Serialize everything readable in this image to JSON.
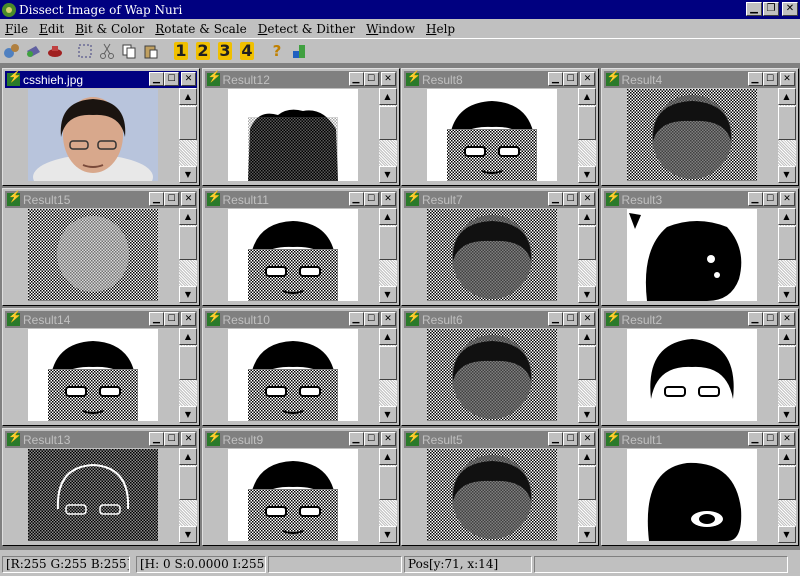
{
  "app": {
    "title": "Dissect Image of Wap Nuri"
  },
  "menu": [
    {
      "label": "File",
      "accel": "F",
      "rest": "ile"
    },
    {
      "label": "Edit",
      "accel": "E",
      "rest": "dit"
    },
    {
      "label": "Bit & Color",
      "accel": "B",
      "rest": "it & Color"
    },
    {
      "label": "Rotate & Scale",
      "accel": "R",
      "rest": "otate & Scale"
    },
    {
      "label": "Detect & Dither",
      "accel": "D",
      "rest": "etect & Dither"
    },
    {
      "label": "Window",
      "accel": "W",
      "rest": "indow"
    },
    {
      "label": "Help",
      "accel": "H",
      "rest": "elp"
    }
  ],
  "toolbar": {
    "icons": [
      "open-icon",
      "save-icon",
      "print-icon",
      "select-icon",
      "cut-icon",
      "copy-icon",
      "paste-icon",
      "layout-1-icon",
      "layout-2-icon",
      "layout-3-icon",
      "layout-4-icon",
      "help-icon",
      "about-icon"
    ],
    "numbers": [
      "1",
      "2",
      "3",
      "4"
    ],
    "help": "?"
  },
  "windows": [
    {
      "title": "csshieh.jpg",
      "active": true,
      "kind": "photo"
    },
    {
      "title": "Result12",
      "kind": "blob"
    },
    {
      "title": "Result8",
      "kind": "face"
    },
    {
      "title": "Result4",
      "kind": "fade"
    },
    {
      "title": "Result15",
      "kind": "noise"
    },
    {
      "title": "Result11",
      "kind": "face"
    },
    {
      "title": "Result7",
      "kind": "fade"
    },
    {
      "title": "Result3",
      "kind": "blob2"
    },
    {
      "title": "Result14",
      "kind": "face"
    },
    {
      "title": "Result10",
      "kind": "face"
    },
    {
      "title": "Result6",
      "kind": "fade"
    },
    {
      "title": "Result2",
      "kind": "solid"
    },
    {
      "title": "Result13",
      "kind": "edges"
    },
    {
      "title": "Result9",
      "kind": "face"
    },
    {
      "title": "Result5",
      "kind": "fade"
    },
    {
      "title": "Result1",
      "kind": "solid2"
    }
  ],
  "status": {
    "rgb": "[R:255 G:255 B:255]",
    "hsi": "[H:  0 S:0.0000 I:255]",
    "pos": "Pos[y:71, x:14]"
  }
}
